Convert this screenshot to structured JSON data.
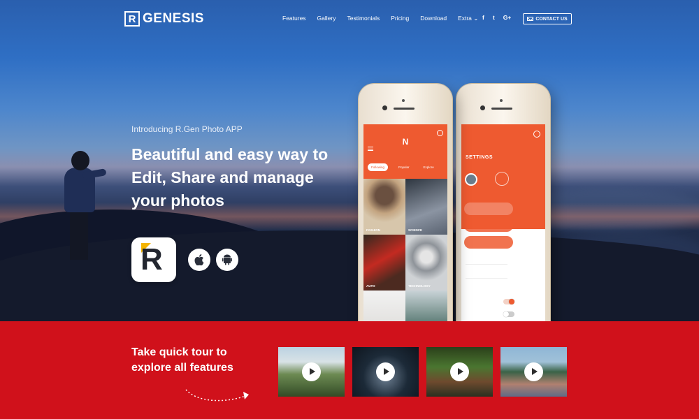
{
  "brand": {
    "mark": "R",
    "name": "GENESIS"
  },
  "nav": {
    "items": [
      "Features",
      "Gallery",
      "Testimonials",
      "Pricing",
      "Download",
      "Extra ⌄"
    ],
    "socials": [
      "f",
      "t",
      "G+"
    ],
    "contact_label": "CONTACT US"
  },
  "hero": {
    "intro": "Introducing R.Gen Photo APP",
    "headline": [
      "Beautiful and easy way to",
      "Edit, Share and manage",
      "your photos"
    ],
    "app_icon_letter": "R",
    "store_icons": [
      "apple-icon",
      "android-icon"
    ]
  },
  "phone_feed": {
    "logo": "N",
    "tabs": [
      "Following",
      "Popular",
      "Explore"
    ],
    "tiles": [
      "FASHION",
      "SCIENCE",
      "AUTO",
      "TECHNOLOGY",
      "",
      ""
    ]
  },
  "phone_settings": {
    "title": "SETTINGS"
  },
  "tour": {
    "title": [
      "Take quick tour to",
      "explore all features"
    ],
    "videos": [
      "castle-video",
      "rain-video",
      "bridge-video",
      "lake-video"
    ]
  },
  "colors": {
    "accent": "#d0111b",
    "app_orange": "#ee5a30"
  }
}
